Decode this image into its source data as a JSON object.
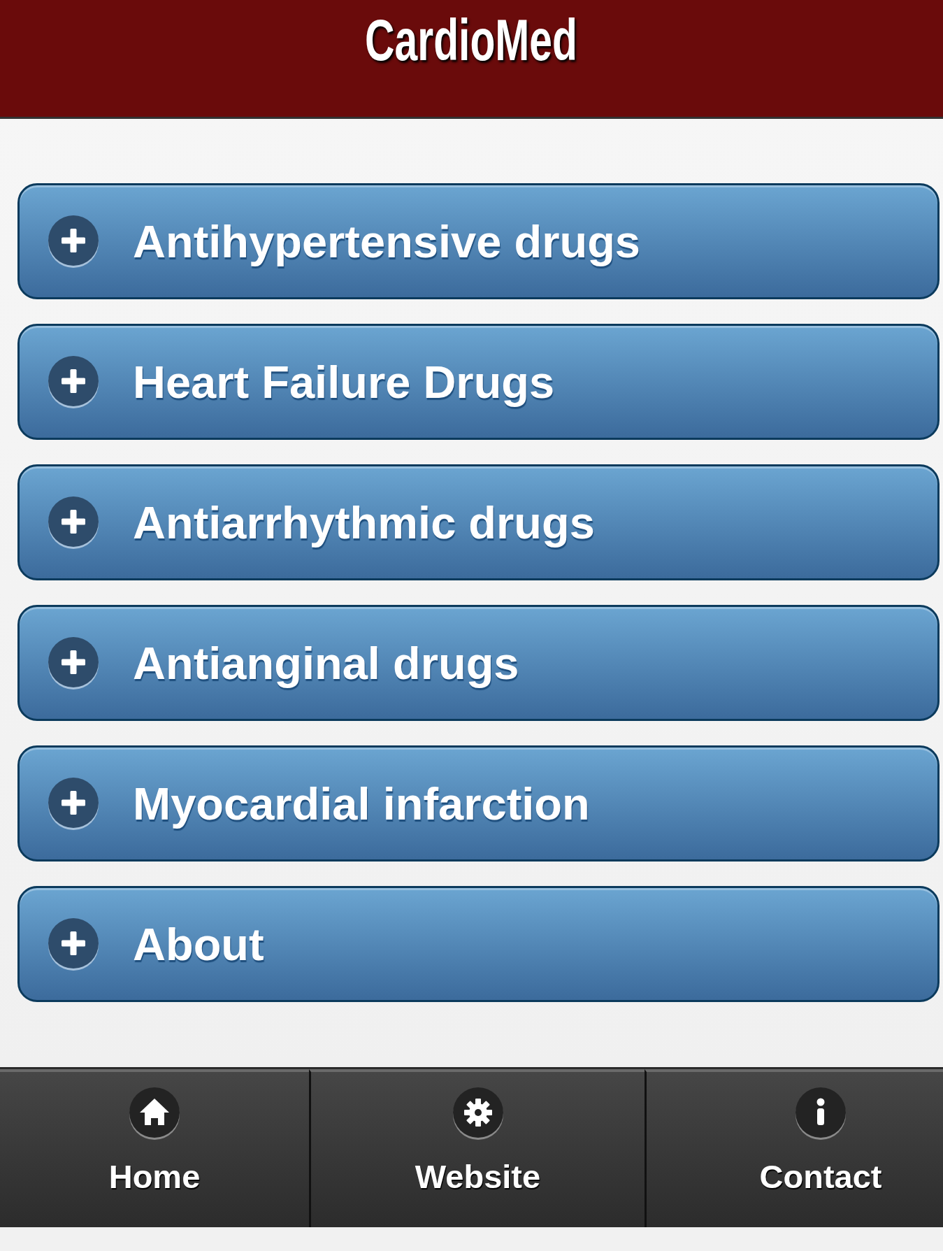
{
  "header": {
    "title": "CardioMed"
  },
  "menu": {
    "items": [
      {
        "label": "Antihypertensive drugs",
        "expanded": false
      },
      {
        "label": "Heart Failure Drugs",
        "expanded": false
      },
      {
        "label": "Antiarrhythmic drugs",
        "expanded": false
      },
      {
        "label": "Antianginal drugs",
        "expanded": false
      },
      {
        "label": "Myocardial infarction",
        "expanded": false
      },
      {
        "label": "About",
        "expanded": false
      }
    ]
  },
  "footer": {
    "tabs": [
      {
        "label": "Home"
      },
      {
        "label": "Website"
      },
      {
        "label": "Contact"
      }
    ]
  }
}
